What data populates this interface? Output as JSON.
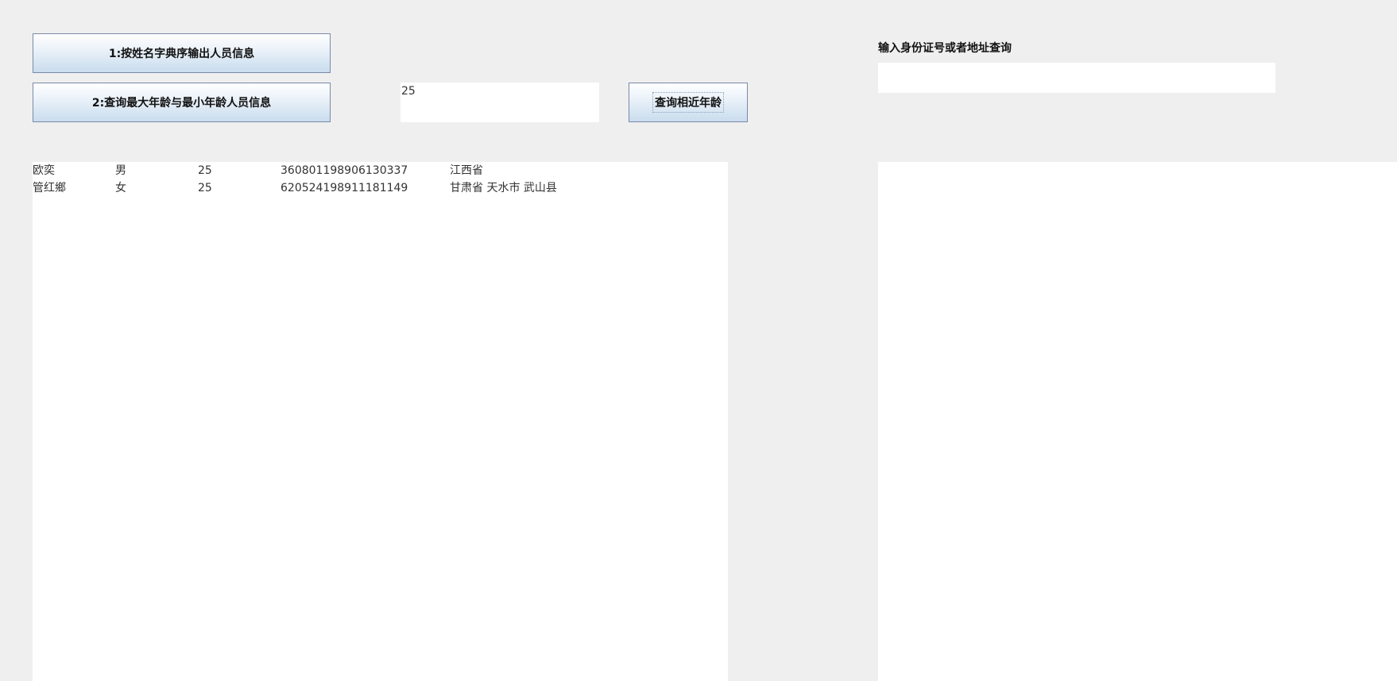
{
  "buttons": {
    "sort_by_name": "1:按姓名字典序输出人员信息",
    "query_min_max_age": "2:查询最大年龄与最小年龄人员信息",
    "query_similar_age": "查询相近年龄"
  },
  "age_field": {
    "value": "25"
  },
  "search": {
    "label": "输入身份证号或者地址查询",
    "value": ""
  },
  "results": {
    "rows": [
      {
        "name": "欧奕",
        "sex": "男",
        "age": "25",
        "id": "360801198906130337",
        "address": "江西省"
      },
      {
        "name": "管红鄉",
        "sex": "女",
        "age": "25",
        "id": "620524198911181149",
        "address": "甘肃省 天水市 武山县"
      }
    ]
  }
}
